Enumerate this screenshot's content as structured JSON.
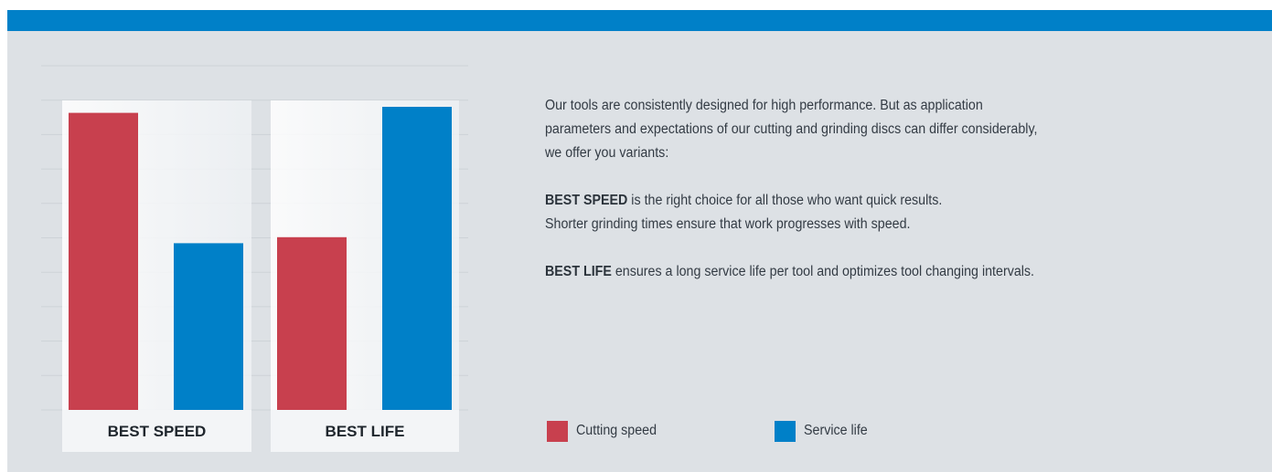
{
  "colors": {
    "accent_bar": "#0080c8",
    "cutting_speed": "#c8404e",
    "service_life": "#0080c8"
  },
  "chart_data": {
    "type": "bar",
    "categories": [
      "BEST SPEED",
      "BEST LIFE"
    ],
    "series": [
      {
        "name": "Cutting speed",
        "values": [
          0.98,
          0.57
        ]
      },
      {
        "name": "Service life",
        "values": [
          0.55,
          1.0
        ]
      }
    ],
    "ylim": [
      0,
      1
    ],
    "grid": true,
    "legend": "right, below text",
    "title": "",
    "xlabel": "",
    "ylabel": ""
  },
  "text": {
    "intro": "Our tools are consistently designed for high performance. But as application parameters and expectations of our cutting and grinding discs can differ considerably, we offer you variants:",
    "intro_lines": [
      "Our tools are consistently designed for high performance. But as application",
      "parameters and expectations of our cutting and grinding discs can differ considerably,",
      "we offer you variants:"
    ],
    "speed_term": "BEST SPEED",
    "speed_line1": " is the right choice for all those who want quick results.",
    "speed_line2": "Shorter grinding times ensure that work progresses with speed.",
    "life_term": "BEST LIFE",
    "life_line": " ensures a long service life per tool and optimizes tool changing intervals."
  },
  "legend": [
    {
      "label": "Cutting speed",
      "color": "#c8404e"
    },
    {
      "label": "Service life",
      "color": "#0080c8"
    }
  ]
}
